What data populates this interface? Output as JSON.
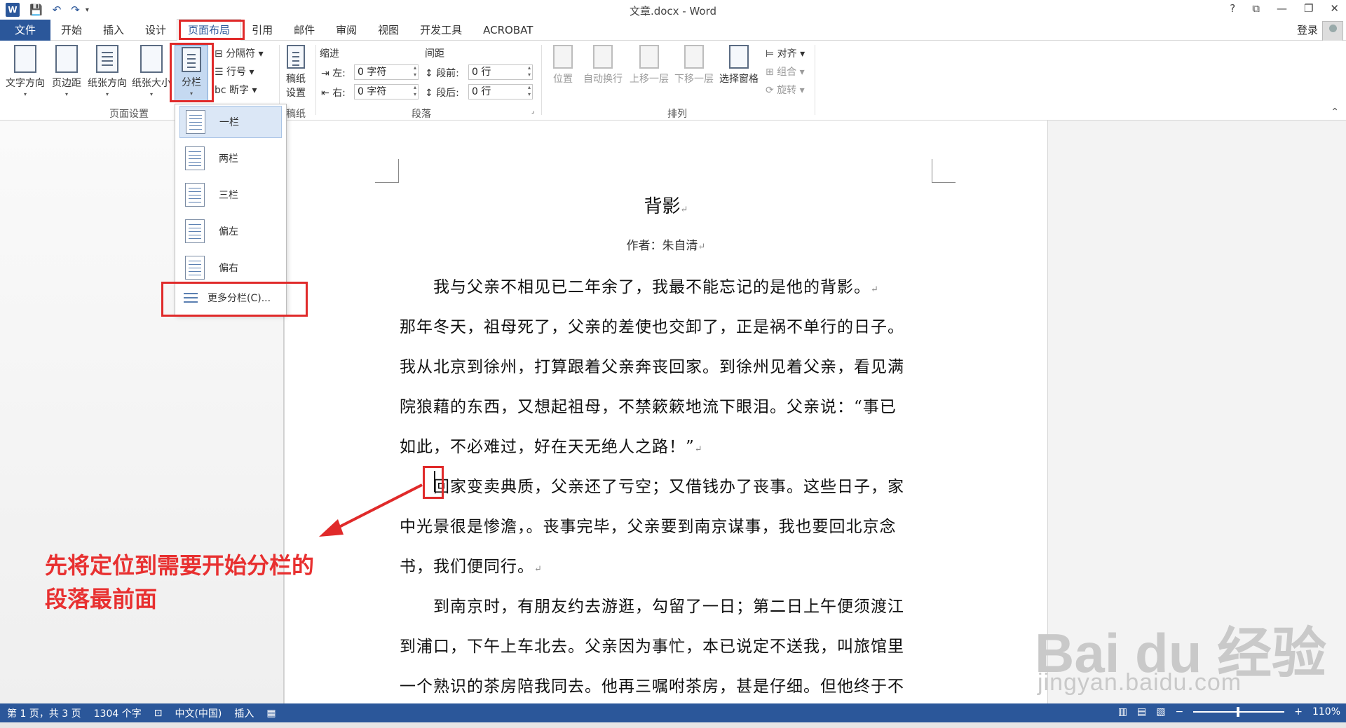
{
  "window": {
    "title": "文章.docx - Word",
    "logo": "W",
    "controls": [
      "?",
      "⧉",
      "—",
      "❐",
      "✕"
    ]
  },
  "qat": {
    "undo": "↶",
    "redo": "↷",
    "customize": "▾"
  },
  "tabs": [
    {
      "label": "文件"
    },
    {
      "label": "开始"
    },
    {
      "label": "插入"
    },
    {
      "label": "设计"
    },
    {
      "label": "页面布局"
    },
    {
      "label": "引用"
    },
    {
      "label": "邮件"
    },
    {
      "label": "审阅"
    },
    {
      "label": "视图"
    },
    {
      "label": "开发工具"
    },
    {
      "label": "ACROBAT"
    }
  ],
  "account": {
    "login": "登录"
  },
  "ribbon": {
    "page_setup": {
      "label": "页面设置",
      "text_direction": "文字方向",
      "margins": "页边距",
      "orientation": "纸张方向",
      "size": "纸张大小",
      "columns": "分栏",
      "breaks": "分隔符",
      "line_numbers": "行号",
      "hyphenation": "断字"
    },
    "manuscript": {
      "label": "稿纸",
      "button": "稿纸\n设置",
      "button_line1": "稿纸",
      "button_line2": "设置"
    },
    "paragraph": {
      "label": "段落",
      "indent_heading": "缩进",
      "spacing_heading": "间距",
      "left_label": "左:",
      "left_value": "0 字符",
      "right_label": "右:",
      "right_value": "0 字符",
      "before_label": "段前:",
      "before_value": "0 行",
      "after_label": "段后:",
      "after_value": "0 行"
    },
    "arrange": {
      "label": "排列",
      "position": "位置",
      "wrap_text": "自动换行",
      "bring_forward": "上移一层",
      "send_backward": "下移一层",
      "selection_pane": "选择窗格",
      "align": "对齐",
      "group": "组合",
      "rotate": "旋转"
    }
  },
  "columns_menu": {
    "items": [
      {
        "label": "一栏"
      },
      {
        "label": "两栏"
      },
      {
        "label": "三栏"
      },
      {
        "label": "偏左"
      },
      {
        "label": "偏右"
      }
    ],
    "more": "更多分栏(C)..."
  },
  "document": {
    "title": "背影",
    "author": "作者：朱自清",
    "lines": [
      "　　我与父亲不相见已二年余了，我最不能忘记的是他的背影。",
      "那年冬天，祖母死了，父亲的差使也交卸了，正是祸不单行的日子。",
      "我从北京到徐州，打算跟着父亲奔丧回家。到徐州见着父亲，看见满",
      "院狼藉的东西，又想起祖母，不禁簌簌地流下眼泪。父亲说：“事已",
      "如此，不必难过，好在天无绝人之路！”",
      "　　回家变卖典质，父亲还了亏空；又借钱办了丧事。这些日子，家",
      "中光景很是惨澹，。丧事完毕，父亲要到南京谋事，我也要回北京念",
      "书，我们便同行。",
      "　　到南京时，有朋友约去游逛，勾留了一日；第二日上午便须渡江",
      "到浦口，下午上车北去。父亲因为事忙，本已说定不送我，叫旅馆里",
      "一个熟识的茶房陪我同去。他再三嘱咐茶房，甚是仔细。但他终于不"
    ],
    "para_mark": "↵"
  },
  "annotation": {
    "line1": "先将定位到需要开始分栏的",
    "line2": "段落最前面",
    "color": "#e02a2a"
  },
  "watermark": {
    "text": "Bai du 经验",
    "sub": "jingyan.baidu.com"
  },
  "status": {
    "page": "第 1 页，共 3 页",
    "words": "1304 个字",
    "language": "中文(中国)",
    "mode": "插入",
    "zoom_minus": "−",
    "zoom_plus": "+",
    "zoom": "110%"
  },
  "colors": {
    "accent": "#2b579a",
    "highlight": "#e02a2a"
  }
}
